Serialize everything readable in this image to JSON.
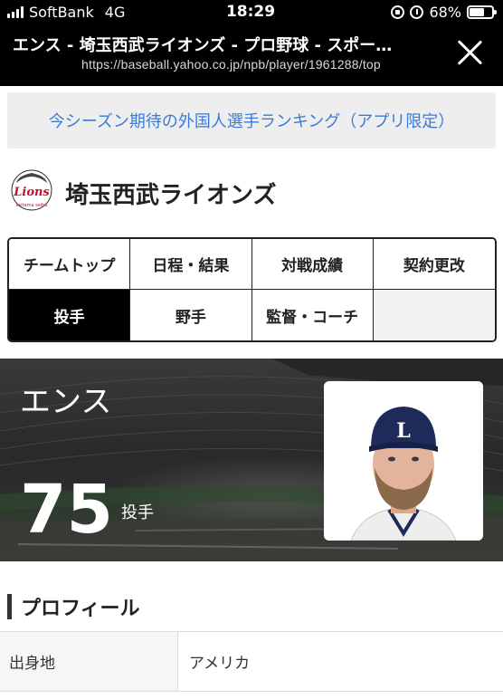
{
  "status_bar": {
    "carrier": "SoftBank",
    "network": "4G",
    "time": "18:29",
    "battery": "68%",
    "battery_level": 0.68
  },
  "browser": {
    "title": "エンス - 埼玉西武ライオンズ - プロ野球 - スポー…",
    "url": "https://baseball.yahoo.co.jp/npb/player/1961288/top"
  },
  "banner": {
    "text": "今シーズン期待の外国人選手ランキング（アプリ限定）"
  },
  "team": {
    "name": "埼玉西武ライオンズ",
    "logo_text": "Lions",
    "logo_subtext": "saitama seibu"
  },
  "nav": {
    "items": [
      {
        "label": "チームトップ"
      },
      {
        "label": "日程・結果"
      },
      {
        "label": "対戦成績"
      },
      {
        "label": "契約更改"
      },
      {
        "label": "投手"
      },
      {
        "label": "野手"
      },
      {
        "label": "監督・コーチ"
      },
      {
        "label": ""
      }
    ]
  },
  "player": {
    "name": "エンス",
    "number": "75",
    "position": "投手"
  },
  "profile": {
    "heading": "プロフィール",
    "rows": [
      {
        "key": "出身地",
        "value": "アメリカ"
      }
    ]
  }
}
